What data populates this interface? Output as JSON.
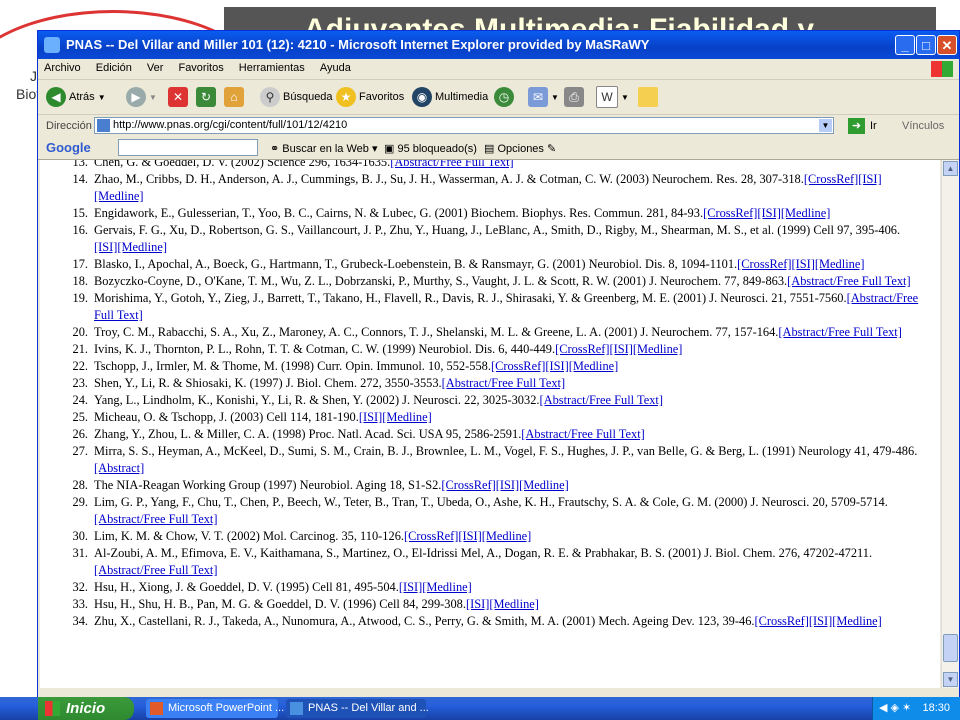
{
  "slide": {
    "title": "Adjuvantes Multimedia: Fiabilidad y",
    "logo_line1": "J",
    "logo_line2": "Biote"
  },
  "window": {
    "title": "PNAS -- Del Villar and Miller 101 (12): 4210 - Microsoft Internet Explorer provided by MaSRaWY",
    "btn_min": "_",
    "btn_max": "□",
    "btn_close": "✕"
  },
  "menu": [
    "Archivo",
    "Edición",
    "Ver",
    "Favoritos",
    "Herramientas",
    "Ayuda"
  ],
  "toolbar": {
    "back": "Atrás",
    "search": "Búsqueda",
    "favorites": "Favoritos",
    "media": "Multimedia"
  },
  "address": {
    "label": "Dirección",
    "url": "http://www.pnas.org/cgi/content/full/101/12/4210",
    "go": "Ir",
    "links": "Vínculos"
  },
  "google": {
    "logo": "Google",
    "search_web": "Buscar en la Web",
    "blocked": "95 bloqueado(s)",
    "options": "Opciones"
  },
  "references": [
    {
      "num": "13.",
      "text": "Chen, G. & Goeddel, D. V. (2002) Science 296, 1634-1635.",
      "links": "[Abstract/Free Full Text]"
    },
    {
      "num": "14.",
      "text": "Zhao, M., Cribbs, D. H., Anderson, A. J., Cummings, B. J., Su, J. H., Wasserman, A. J. & Cotman, C. W. (2003) Neurochem. Res. 28, 307-318.",
      "links": "[CrossRef][ISI][Medline]"
    },
    {
      "num": "15.",
      "text": "Engidawork, E., Gulesserian, T., Yoo, B. C., Cairns, N. & Lubec, G. (2001) Biochem. Biophys. Res. Commun. 281, 84-93.",
      "links": "[CrossRef][ISI][Medline]"
    },
    {
      "num": "16.",
      "text": "Gervais, F. G., Xu, D., Robertson, G. S., Vaillancourt, J. P., Zhu, Y., Huang, J., LeBlanc, A., Smith, D., Rigby, M., Shearman, M. S., et al. (1999) Cell 97, 395-406.",
      "links": "[ISI][Medline]"
    },
    {
      "num": "17.",
      "text": "Blasko, I., Apochal, A., Boeck, G., Hartmann, T., Grubeck-Loebenstein, B. & Ransmayr, G. (2001) Neurobiol. Dis. 8, 1094-1101.",
      "links": "[CrossRef][ISI][Medline]"
    },
    {
      "num": "18.",
      "text": "Bozyczko-Coyne, D., O'Kane, T. M., Wu, Z. L., Dobrzanski, P., Murthy, S., Vaught, J. L. & Scott, R. W. (2001) J. Neurochem. 77, 849-863.",
      "links": "[Abstract/Free Full Text]"
    },
    {
      "num": "19.",
      "text": "Morishima, Y., Gotoh, Y., Zieg, J., Barrett, T., Takano, H., Flavell, R., Davis, R. J., Shirasaki, Y. & Greenberg, M. E. (2001) J. Neurosci. 21, 7551-7560.",
      "links": "[Abstract/Free Full Text]"
    },
    {
      "num": "20.",
      "text": "Troy, C. M., Rabacchi, S. A., Xu, Z., Maroney, A. C., Connors, T. J., Shelanski, M. L. & Greene, L. A. (2001) J. Neurochem. 77, 157-164.",
      "links": "[Abstract/Free Full Text]"
    },
    {
      "num": "21.",
      "text": "Ivins, K. J., Thornton, P. L., Rohn, T. T. & Cotman, C. W. (1999) Neurobiol. Dis. 6, 440-449.",
      "links": "[CrossRef][ISI][Medline]"
    },
    {
      "num": "22.",
      "text": "Tschopp, J., Irmler, M. & Thome, M. (1998) Curr. Opin. Immunol. 10, 552-558.",
      "links": "[CrossRef][ISI][Medline]"
    },
    {
      "num": "23.",
      "text": "Shen, Y., Li, R. & Shiosaki, K. (1997) J. Biol. Chem. 272, 3550-3553.",
      "links": "[Abstract/Free Full Text]"
    },
    {
      "num": "24.",
      "text": "Yang, L., Lindholm, K., Konishi, Y., Li, R. & Shen, Y. (2002) J. Neurosci. 22, 3025-3032.",
      "links": "[Abstract/Free Full Text]"
    },
    {
      "num": "25.",
      "text": "Micheau, O. & Tschopp, J. (2003) Cell 114, 181-190.",
      "links": "[ISI][Medline]"
    },
    {
      "num": "26.",
      "text": "Zhang, Y., Zhou, L. & Miller, C. A. (1998) Proc. Natl. Acad. Sci. USA 95, 2586-2591.",
      "links": "[Abstract/Free Full Text]"
    },
    {
      "num": "27.",
      "text": "Mirra, S. S., Heyman, A., McKeel, D., Sumi, S. M., Crain, B. J., Brownlee, L. M., Vogel, F. S., Hughes, J. P., van Belle, G. & Berg, L. (1991) Neurology 41, 479-486.",
      "links": "[Abstract]"
    },
    {
      "num": "28.",
      "text": "The NIA-Reagan Working Group (1997) Neurobiol. Aging 18, S1-S2.",
      "links": "[CrossRef][ISI][Medline]"
    },
    {
      "num": "29.",
      "text": "Lim, G. P., Yang, F., Chu, T., Chen, P., Beech, W., Teter, B., Tran, T., Ubeda, O., Ashe, K. H., Frautschy, S. A. & Cole, G. M. (2000) J. Neurosci. 20, 5709-5714.",
      "links": "[Abstract/Free Full Text]"
    },
    {
      "num": "30.",
      "text": "Lim, K. M. & Chow, V. T. (2002) Mol. Carcinog. 35, 110-126.",
      "links": "[CrossRef][ISI][Medline]"
    },
    {
      "num": "31.",
      "text": "Al-Zoubi, A. M., Efimova, E. V., Kaithamana, S., Martinez, O., El-Idrissi Mel, A., Dogan, R. E. & Prabhakar, B. S. (2001) J. Biol. Chem. 276, 47202-47211.",
      "links": "[Abstract/Free Full Text]"
    },
    {
      "num": "32.",
      "text": "Hsu, H., Xiong, J. & Goeddel, D. V. (1995) Cell 81, 495-504.",
      "links": "[ISI][Medline]"
    },
    {
      "num": "33.",
      "text": "Hsu, H., Shu, H. B., Pan, M. G. & Goeddel, D. V. (1996) Cell 84, 299-308.",
      "links": "[ISI][Medline]"
    },
    {
      "num": "34.",
      "text": "Zhu, X., Castellani, R. J., Takeda, A., Nunomura, A., Atwood, C. S., Perry, G. & Smith, M. A. (2001) Mech. Ageing Dev. 123, 39-46.",
      "links": "[CrossRef][ISI][Medline]"
    }
  ],
  "taskbar": {
    "start": "Inicio",
    "task1": "Microsoft PowerPoint ...",
    "task2": "PNAS -- Del Villar and ...",
    "clock": "18:30"
  },
  "colors": {
    "link": "#0000cc",
    "titlebar": "#0a5cf0",
    "start": "#2f8a2f"
  }
}
